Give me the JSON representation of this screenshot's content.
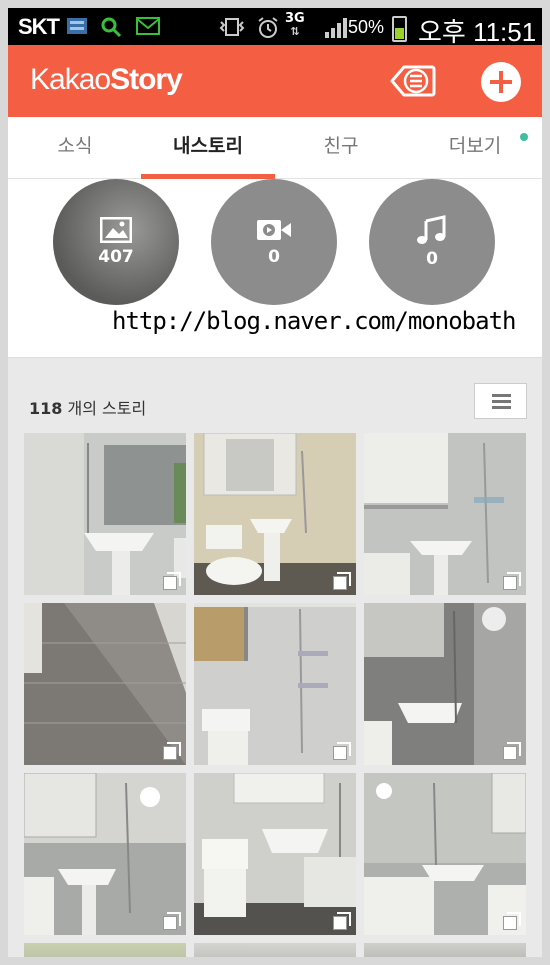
{
  "status_bar": {
    "carrier": "SKT",
    "network": "3G",
    "battery": "50%",
    "battery_level": 0.5,
    "time": "오후 11:51"
  },
  "app_bar": {
    "logo_prefix": "Kakao",
    "logo_suffix": "Story",
    "colors": {
      "brand": "#f45e43",
      "tab_dot": "#3dbfa0"
    }
  },
  "tabs": [
    {
      "label": "소식"
    },
    {
      "label": "내스토리"
    },
    {
      "label": "친구"
    },
    {
      "label": "더보기"
    }
  ],
  "media": {
    "photo_count": "407",
    "video_count": "0",
    "music_count": "0"
  },
  "watermark": "http://blog.naver.com/monobath",
  "stories": {
    "count": "118",
    "count_suffix": "개의 스토리"
  },
  "grid": {
    "columns": 3,
    "visible_rows": 3,
    "tiles": [
      {
        "name": "photo-bathroom-1",
        "icon": "multi-photo-icon"
      },
      {
        "name": "photo-bathroom-2",
        "icon": "multi-photo-icon"
      },
      {
        "name": "photo-bathroom-3",
        "icon": "multi-photo-icon"
      },
      {
        "name": "photo-bathroom-4",
        "icon": "multi-photo-icon"
      },
      {
        "name": "photo-bathroom-5",
        "icon": "multi-photo-icon"
      },
      {
        "name": "photo-bathroom-6",
        "icon": "multi-photo-icon"
      },
      {
        "name": "photo-bathroom-7",
        "icon": "multi-photo-icon"
      },
      {
        "name": "photo-bathroom-8",
        "icon": "multi-photo-icon"
      },
      {
        "name": "photo-bathroom-9",
        "icon": "multi-photo-icon"
      }
    ]
  }
}
